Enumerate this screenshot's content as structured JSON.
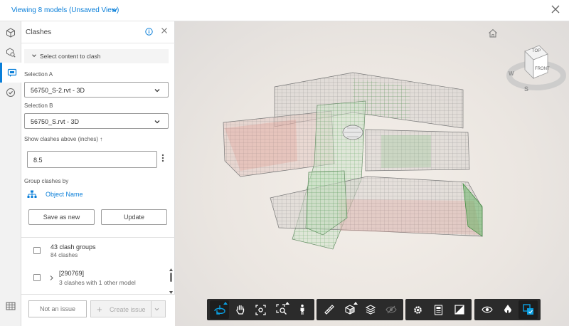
{
  "header": {
    "title": "Viewing 8 models (Unsaved View)"
  },
  "rail": {
    "items": [
      {
        "icon": "cube-icon"
      },
      {
        "icon": "search-model-icon"
      },
      {
        "icon": "clashes-icon",
        "active": true
      },
      {
        "icon": "issues-check-icon"
      },
      {
        "icon": "table-icon"
      }
    ]
  },
  "panel": {
    "title": "Clashes",
    "section_label": "Select content to clash",
    "selection_a_label": "Selection A",
    "selection_a_value": "56750_S-2.rvt - 3D",
    "selection_b_label": "Selection B",
    "selection_b_value": "56750_S.rvt - 3D",
    "threshold_label": "Show clashes above (inches) ↑",
    "threshold_value": "8.5",
    "group_by_label": "Group clashes by",
    "group_by_value": "Object Name",
    "save_as_new_label": "Save as new",
    "update_label": "Update"
  },
  "clash_list": {
    "summary_title": "43 clash groups",
    "summary_sub": "84 clashes",
    "items": [
      {
        "id": "[290769]",
        "desc": "3 clashes with 1 other model"
      }
    ]
  },
  "footer": {
    "not_issue_label": "Not an issue",
    "create_issue_label": "Create issue"
  },
  "viewcube": {
    "top": "TOP",
    "front": "FRONT",
    "west": "W",
    "south": "S"
  },
  "colors": {
    "accent": "#0a7fd9",
    "toolbar_bg": "#2b2b2b",
    "clash_red": "#d85a5a",
    "clash_green": "#4fae4f"
  },
  "toolbar_groups": [
    [
      "orbit-icon",
      "pan-hand-icon",
      "fit-view-icon",
      "zoom-window-icon",
      "walk-person-icon"
    ],
    [
      "measure-ruler-icon",
      "section-box-icon",
      "layers-icon",
      "hide-eye-icon"
    ],
    [
      "settings-gear-icon",
      "properties-icon",
      "fullscreen-icon"
    ],
    [
      "visibility-eye-icon",
      "ghosting-icon",
      "clash-view-icon"
    ]
  ]
}
